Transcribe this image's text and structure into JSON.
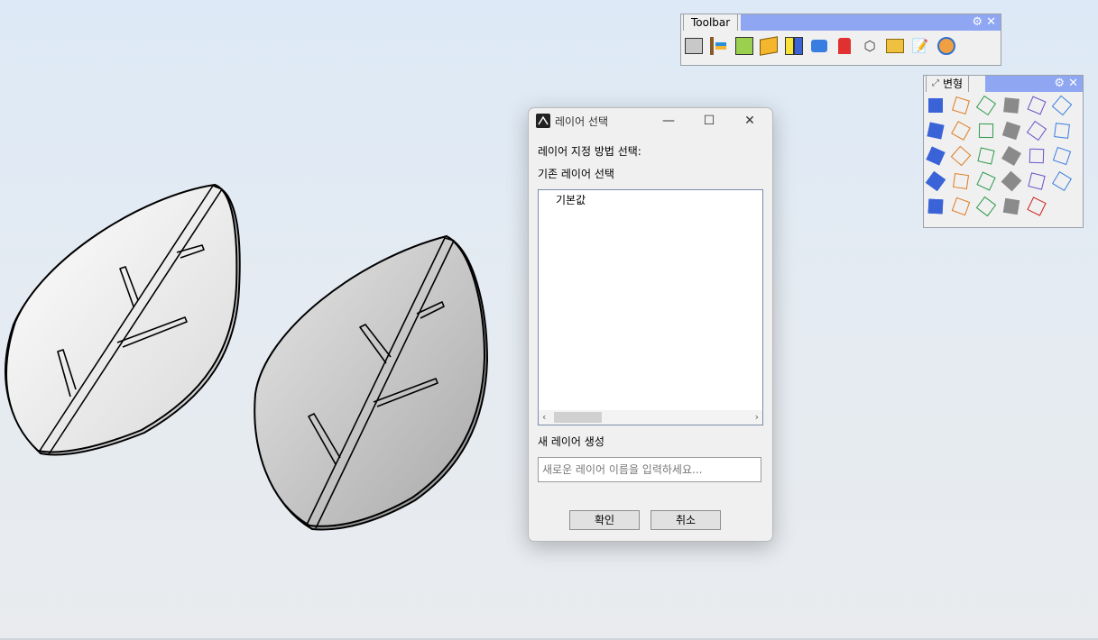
{
  "toolbar_panel": {
    "tab_label": "Toolbar",
    "icons": [
      "rectangle-icon",
      "dimension-icon",
      "layer-calculator-icon",
      "box-icon",
      "layers-icon",
      "analyze-icon",
      "bolt-icon",
      "object-export-icon",
      "folder-icon",
      "properties-edit-icon",
      "render-icon"
    ]
  },
  "transform_panel": {
    "tab_label": "변형",
    "icons": [
      "move-icon",
      "copy-icon",
      "curve-icon",
      "array-icon",
      "bend-icon",
      "box-edit-icon",
      "mirror-icon",
      "rotate-icon",
      "sphere-icon",
      "align-icon",
      "scale-icon",
      "shear-icon",
      "orient-icon",
      "grid-array-icon",
      "polar-array-icon",
      "flow-icon",
      "cage-icon",
      "taper-icon",
      "twist-icon",
      "project-icon",
      "smooth-icon",
      "slash-icon",
      "slash-alt-icon",
      "wave-icon",
      "stretch-icon",
      "cylinder-icon",
      "mesh-icon",
      "cage-edit-icon",
      "arrow-icon"
    ]
  },
  "dialog": {
    "title": "레이어 선택",
    "prompt": "레이어 지정 방법 선택:",
    "existing_label": "기존 레이어 선택",
    "existing_items": [
      "기본값"
    ],
    "new_label": "새 레이어 생성",
    "new_placeholder": "새로운 레이어 이름을 입력하세요...",
    "new_value": "",
    "ok_label": "확인",
    "cancel_label": "취소"
  },
  "colors": {
    "panel_bar": "#8fa6f2",
    "viewport_top": "#dde9f6",
    "viewport_bottom": "#e9ebee"
  }
}
